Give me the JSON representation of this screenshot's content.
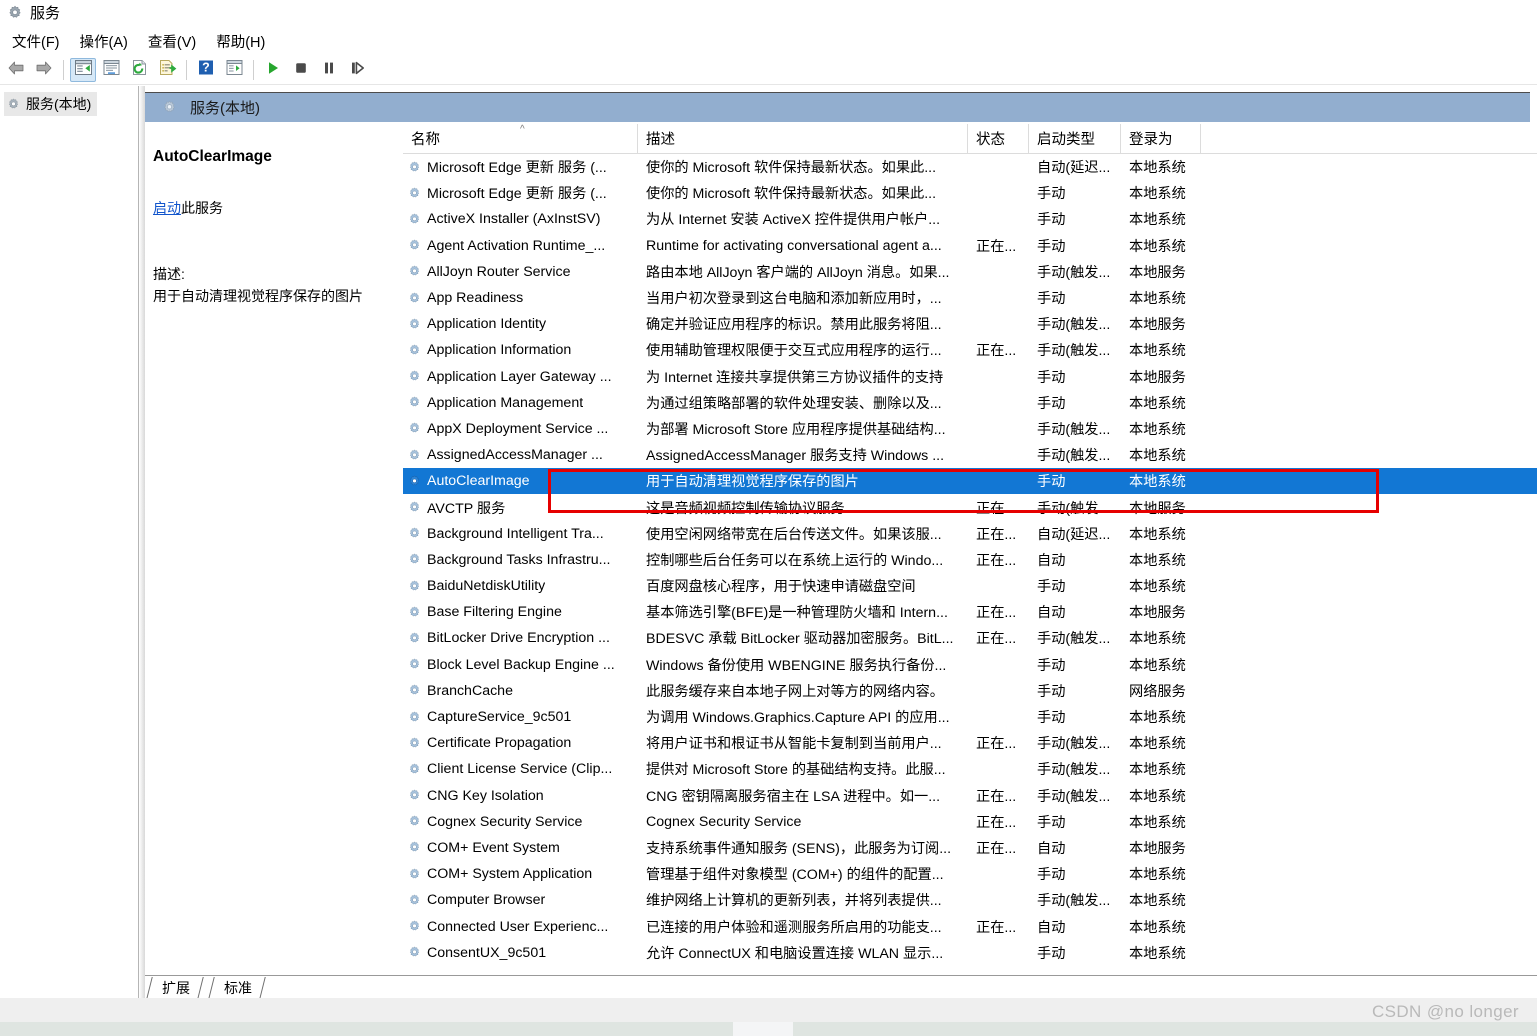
{
  "window": {
    "title": "服务",
    "icon": "services-gear-icon"
  },
  "menu": {
    "items": [
      {
        "label": "文件(F)",
        "name": "menu-file"
      },
      {
        "label": "操作(A)",
        "name": "menu-action"
      },
      {
        "label": "查看(V)",
        "name": "menu-view"
      },
      {
        "label": "帮助(H)",
        "name": "menu-help"
      }
    ]
  },
  "toolbar": {
    "buttons": [
      {
        "name": "back-button",
        "icon": "arrow-left-icon",
        "active": false
      },
      {
        "name": "forward-button",
        "icon": "arrow-right-icon",
        "active": false
      },
      {
        "name": "show-hide-tree-button",
        "icon": "console-tree-icon",
        "active": true
      },
      {
        "name": "properties-button",
        "icon": "properties-window-icon",
        "active": false
      },
      {
        "name": "refresh-button",
        "icon": "refresh-page-icon",
        "active": false
      },
      {
        "name": "export-list-button",
        "icon": "export-list-icon",
        "active": false
      },
      {
        "name": "help-button",
        "icon": "question-mark-icon",
        "active": false
      },
      {
        "name": "show-action-pane-button",
        "icon": "action-pane-icon",
        "active": false
      },
      {
        "name": "start-service-button",
        "icon": "play-icon",
        "active": false
      },
      {
        "name": "stop-service-button",
        "icon": "stop-square-icon",
        "active": false
      },
      {
        "name": "pause-service-button",
        "icon": "pause-icon",
        "active": false
      },
      {
        "name": "restart-service-button",
        "icon": "restart-icon",
        "active": false
      }
    ]
  },
  "tree": {
    "root_label": "服务(本地)"
  },
  "console_header": {
    "label": "服务(本地)",
    "icon": "services-gear-icon"
  },
  "detail": {
    "service_name": "AutoClearImage",
    "action_link": "启动",
    "action_suffix": "此服务",
    "description_label": "描述:",
    "description_text": "用于自动清理视觉程序保存的图片"
  },
  "list": {
    "columns": [
      {
        "key": "name",
        "label": "名称",
        "sorted": true
      },
      {
        "key": "desc",
        "label": "描述",
        "sorted": false
      },
      {
        "key": "state",
        "label": "状态",
        "sorted": false
      },
      {
        "key": "start",
        "label": "启动类型",
        "sorted": false
      },
      {
        "key": "logon",
        "label": "登录为",
        "sorted": false
      }
    ],
    "rows": [
      {
        "name": "Microsoft Edge 更新 服务 (...",
        "desc": "使你的 Microsoft 软件保持最新状态。如果此...",
        "state": "",
        "start": "自动(延迟...",
        "logon": "本地系统",
        "selected": false
      },
      {
        "name": "Microsoft Edge 更新 服务 (...",
        "desc": "使你的 Microsoft 软件保持最新状态。如果此...",
        "state": "",
        "start": "手动",
        "logon": "本地系统",
        "selected": false
      },
      {
        "name": "ActiveX Installer (AxInstSV)",
        "desc": "为从 Internet 安装 ActiveX 控件提供用户帐户...",
        "state": "",
        "start": "手动",
        "logon": "本地系统",
        "selected": false
      },
      {
        "name": "Agent Activation Runtime_...",
        "desc": "Runtime for activating conversational agent a...",
        "state": "正在...",
        "start": "手动",
        "logon": "本地系统",
        "selected": false
      },
      {
        "name": "AllJoyn Router Service",
        "desc": "路由本地 AllJoyn 客户端的 AllJoyn 消息。如果...",
        "state": "",
        "start": "手动(触发...",
        "logon": "本地服务",
        "selected": false
      },
      {
        "name": "App Readiness",
        "desc": "当用户初次登录到这台电脑和添加新应用时，...",
        "state": "",
        "start": "手动",
        "logon": "本地系统",
        "selected": false
      },
      {
        "name": "Application Identity",
        "desc": "确定并验证应用程序的标识。禁用此服务将阻...",
        "state": "",
        "start": "手动(触发...",
        "logon": "本地服务",
        "selected": false
      },
      {
        "name": "Application Information",
        "desc": "使用辅助管理权限便于交互式应用程序的运行...",
        "state": "正在...",
        "start": "手动(触发...",
        "logon": "本地系统",
        "selected": false
      },
      {
        "name": "Application Layer Gateway ...",
        "desc": "为 Internet 连接共享提供第三方协议插件的支持",
        "state": "",
        "start": "手动",
        "logon": "本地服务",
        "selected": false
      },
      {
        "name": "Application Management",
        "desc": "为通过组策略部署的软件处理安装、删除以及...",
        "state": "",
        "start": "手动",
        "logon": "本地系统",
        "selected": false
      },
      {
        "name": "AppX Deployment Service ...",
        "desc": "为部署 Microsoft Store 应用程序提供基础结构...",
        "state": "",
        "start": "手动(触发...",
        "logon": "本地系统",
        "selected": false
      },
      {
        "name": "AssignedAccessManager ...",
        "desc": "AssignedAccessManager 服务支持 Windows ...",
        "state": "",
        "start": "手动(触发...",
        "logon": "本地系统",
        "selected": false
      },
      {
        "name": "AutoClearImage",
        "desc": "用于自动清理视觉程序保存的图片",
        "state": "",
        "start": "手动",
        "logon": "本地系统",
        "selected": true
      },
      {
        "name": "AVCTP 服务",
        "desc": "这是音频视频控制传输协议服务",
        "state": "正在...",
        "start": "手动(触发...",
        "logon": "本地服务",
        "selected": false
      },
      {
        "name": "Background Intelligent Tra...",
        "desc": "使用空闲网络带宽在后台传送文件。如果该服...",
        "state": "正在...",
        "start": "自动(延迟...",
        "logon": "本地系统",
        "selected": false
      },
      {
        "name": "Background Tasks Infrastru...",
        "desc": "控制哪些后台任务可以在系统上运行的 Windo...",
        "state": "正在...",
        "start": "自动",
        "logon": "本地系统",
        "selected": false
      },
      {
        "name": "BaiduNetdiskUtility",
        "desc": "百度网盘核心程序，用于快速申请磁盘空间",
        "state": "",
        "start": "手动",
        "logon": "本地系统",
        "selected": false
      },
      {
        "name": "Base Filtering Engine",
        "desc": "基本筛选引擎(BFE)是一种管理防火墙和 Intern...",
        "state": "正在...",
        "start": "自动",
        "logon": "本地服务",
        "selected": false
      },
      {
        "name": "BitLocker Drive Encryption ...",
        "desc": "BDESVC 承载 BitLocker 驱动器加密服务。BitL...",
        "state": "正在...",
        "start": "手动(触发...",
        "logon": "本地系统",
        "selected": false
      },
      {
        "name": "Block Level Backup Engine ...",
        "desc": "Windows 备份使用 WBENGINE 服务执行备份...",
        "state": "",
        "start": "手动",
        "logon": "本地系统",
        "selected": false
      },
      {
        "name": "BranchCache",
        "desc": "此服务缓存来自本地子网上对等方的网络内容。",
        "state": "",
        "start": "手动",
        "logon": "网络服务",
        "selected": false
      },
      {
        "name": "CaptureService_9c501",
        "desc": "为调用 Windows.Graphics.Capture API 的应用...",
        "state": "",
        "start": "手动",
        "logon": "本地系统",
        "selected": false
      },
      {
        "name": "Certificate Propagation",
        "desc": "将用户证书和根证书从智能卡复制到当前用户...",
        "state": "正在...",
        "start": "手动(触发...",
        "logon": "本地系统",
        "selected": false
      },
      {
        "name": "Client License Service (Clip...",
        "desc": "提供对 Microsoft Store 的基础结构支持。此服...",
        "state": "",
        "start": "手动(触发...",
        "logon": "本地系统",
        "selected": false
      },
      {
        "name": "CNG Key Isolation",
        "desc": "CNG 密钥隔离服务宿主在 LSA 进程中。如一...",
        "state": "正在...",
        "start": "手动(触发...",
        "logon": "本地系统",
        "selected": false
      },
      {
        "name": "Cognex Security Service",
        "desc": "Cognex Security Service",
        "state": "正在...",
        "start": "手动",
        "logon": "本地系统",
        "selected": false
      },
      {
        "name": "COM+ Event System",
        "desc": "支持系统事件通知服务 (SENS)，此服务为订阅...",
        "state": "正在...",
        "start": "自动",
        "logon": "本地服务",
        "selected": false
      },
      {
        "name": "COM+ System Application",
        "desc": "管理基于组件对象模型 (COM+) 的组件的配置...",
        "state": "",
        "start": "手动",
        "logon": "本地系统",
        "selected": false
      },
      {
        "name": "Computer Browser",
        "desc": "维护网络上计算机的更新列表，并将列表提供...",
        "state": "",
        "start": "手动(触发...",
        "logon": "本地系统",
        "selected": false
      },
      {
        "name": "Connected User Experienc...",
        "desc": "已连接的用户体验和遥测服务所启用的功能支...",
        "state": "正在...",
        "start": "自动",
        "logon": "本地系统",
        "selected": false
      },
      {
        "name": "ConsentUX_9c501",
        "desc": "允许 ConnectUX 和电脑设置连接 WLAN 显示...",
        "state": "",
        "start": "手动",
        "logon": "本地系统",
        "selected": false
      }
    ]
  },
  "tabs": [
    {
      "label": "扩展",
      "name": "tab-extended",
      "active": true
    },
    {
      "label": "标准",
      "name": "tab-standard",
      "active": false
    }
  ],
  "watermark": "CSDN @no longer",
  "colors": {
    "selection_blue": "#1277d4",
    "console_header_blue": "#92aecf",
    "annotation_red": "#e60000",
    "link_blue": "#1155cc"
  }
}
